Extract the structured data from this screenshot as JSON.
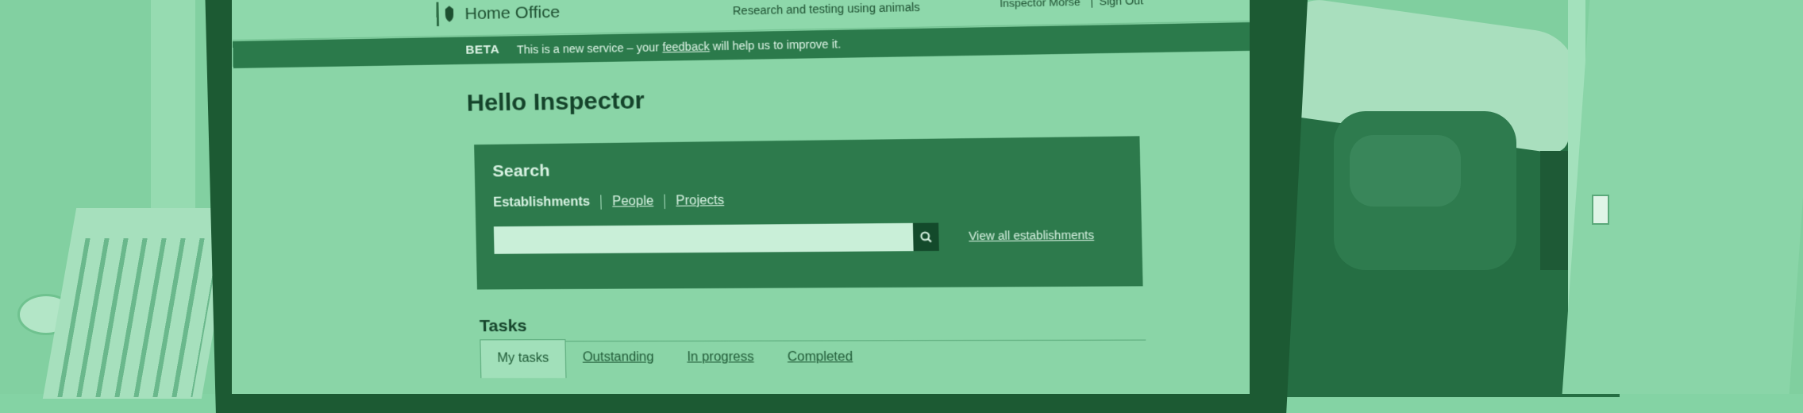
{
  "header": {
    "brand": "Home Office",
    "service_name": "Research and testing using animals",
    "user_name": "Inspector Morse",
    "sign_out": "Sign Out"
  },
  "beta_banner": {
    "tag": "BETA",
    "text_before": "This is a new service – your",
    "link": "feedback",
    "text_after": "will help us to improve it."
  },
  "page": {
    "title": "Hello Inspector"
  },
  "search": {
    "title": "Search",
    "tabs": [
      "Establishments",
      "People",
      "Projects"
    ],
    "input_value": "",
    "view_all": "View all establishments"
  },
  "tasks": {
    "title": "Tasks",
    "tabs": [
      "My tasks",
      "Outstanding",
      "In progress",
      "Completed"
    ],
    "active_tab": "My tasks"
  },
  "colors": {
    "tint": "#84d3a4",
    "dark_green": "#2d7a4c"
  }
}
